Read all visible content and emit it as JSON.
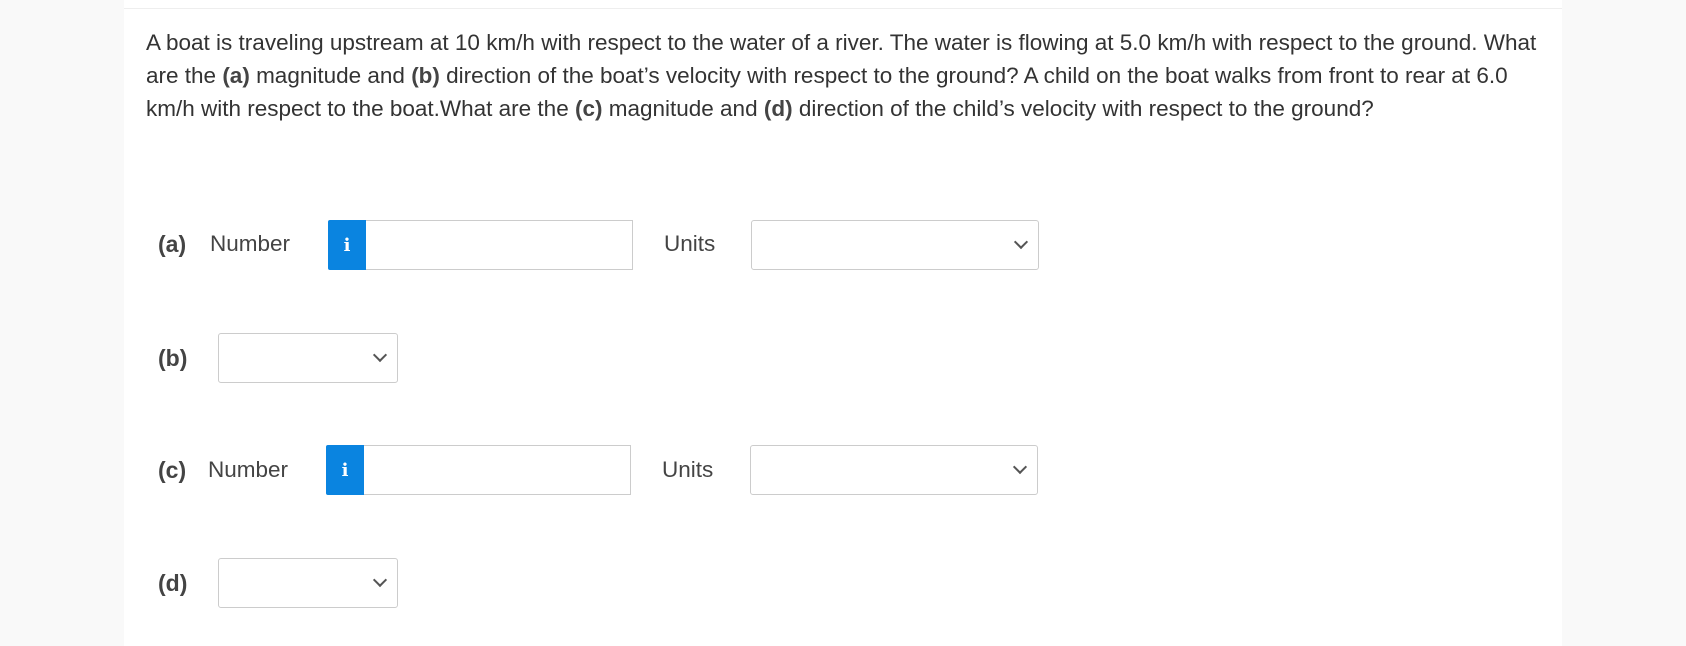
{
  "question": {
    "s1": "A boat is traveling upstream at 10 km/h with respect to the water of a river. The water is flowing at 5.0 km/h with respect to the ground. What are the ",
    "a": "(a)",
    "s2": " magnitude and ",
    "b": "(b)",
    "s3": " direction of the boat’s velocity with respect to the ground? A child on the boat walks from front to rear at 6.0 km/h with respect to the boat.What are the ",
    "c": "(c)",
    "s4": " magnitude and ",
    "d": "(d)",
    "s5": " direction of the child’s velocity with respect to the ground?"
  },
  "parts": {
    "a": {
      "label": "(a)",
      "number_label": "Number",
      "info_icon": "i",
      "value": "",
      "units_label": "Units",
      "units_value": ""
    },
    "b": {
      "label": "(b)",
      "direction_value": ""
    },
    "c": {
      "label": "(c)",
      "number_label": "Number",
      "info_icon": "i",
      "value": "",
      "units_label": "Units",
      "units_value": ""
    },
    "d": {
      "label": "(d)",
      "direction_value": ""
    }
  },
  "colors": {
    "accent": "#0a84e0"
  }
}
